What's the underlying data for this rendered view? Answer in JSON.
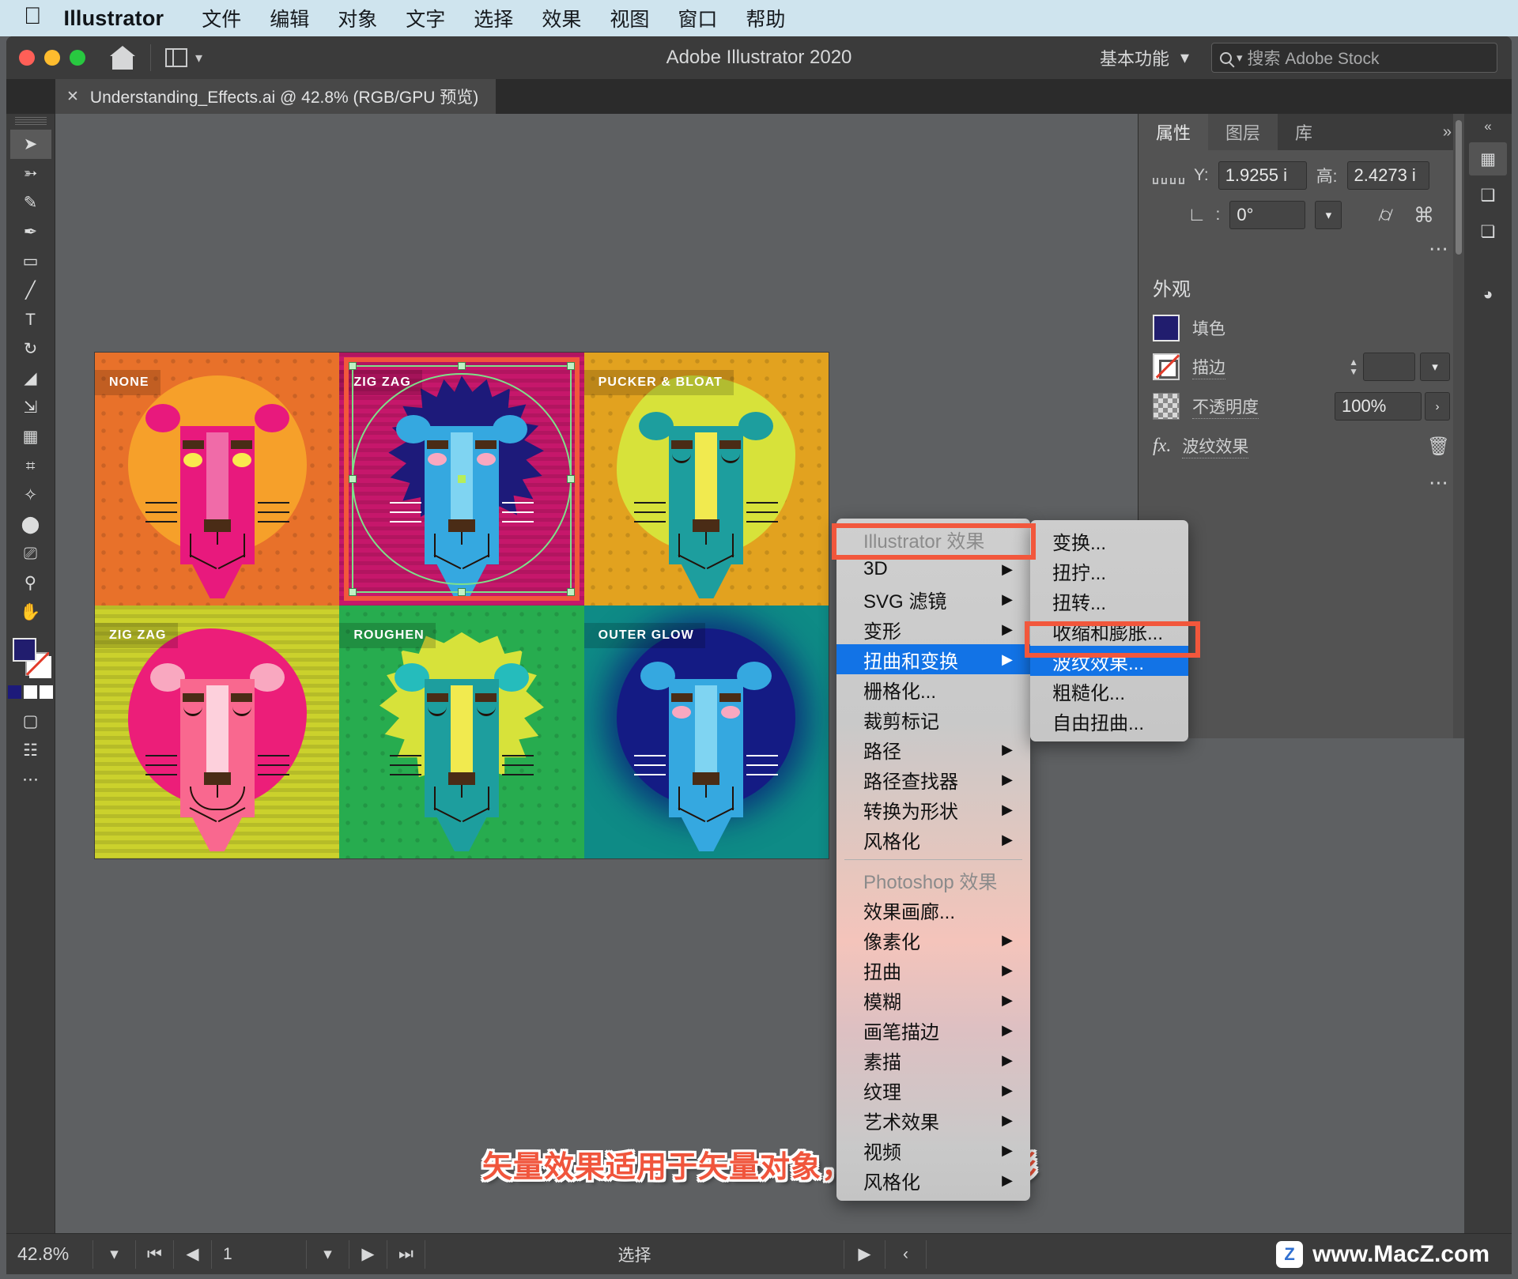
{
  "macmenu": {
    "apple_icon": "apple-icon",
    "app_name": "Illustrator",
    "items": [
      "文件",
      "编辑",
      "对象",
      "文字",
      "选择",
      "效果",
      "视图",
      "窗口",
      "帮助"
    ]
  },
  "titlebar": {
    "title": "Adobe Illustrator 2020",
    "home_icon": "home-icon",
    "arrange_icon": "arrange-documents-icon",
    "workspace_label": "基本功能",
    "workspace_caret": "chevron-down-icon",
    "search_icon": "search-icon",
    "search_caret": "chevron-down-icon",
    "search_placeholder": "搜索 Adobe Stock"
  },
  "tab": {
    "close_icon": "close-icon",
    "title": "Understanding_Effects.ai @ 42.8% (RGB/GPU 预览)"
  },
  "toolbar": {
    "tools": [
      {
        "name": "selection-tool",
        "glyph": "➤"
      },
      {
        "name": "direct-selection-tool",
        "glyph": "➣"
      },
      {
        "name": "pen-tool",
        "glyph": "✒"
      },
      {
        "name": "curvature-tool",
        "glyph": "✎"
      },
      {
        "name": "rectangle-tool",
        "glyph": "▭"
      },
      {
        "name": "paintbrush-tool",
        "glyph": "🖌"
      },
      {
        "name": "type-tool",
        "glyph": "T"
      },
      {
        "name": "rotate-tool",
        "glyph": "↻"
      },
      {
        "name": "eraser-tool",
        "glyph": "◣"
      },
      {
        "name": "scale-tool",
        "glyph": "⇲"
      },
      {
        "name": "gradient-tool",
        "glyph": "▤"
      },
      {
        "name": "eyedropper-tool",
        "glyph": "⌖"
      },
      {
        "name": "blend-tool",
        "glyph": "✧"
      },
      {
        "name": "shape-builder-tool",
        "glyph": "⬤"
      },
      {
        "name": "artboard-tool",
        "glyph": "⛶"
      },
      {
        "name": "zoom-tool",
        "glyph": "🔍"
      },
      {
        "name": "hand-tool",
        "glyph": "✋"
      },
      {
        "name": "more-tools",
        "glyph": "•••"
      }
    ],
    "fill_color": "#211d6e",
    "stroke_color": "none"
  },
  "rightdock": {
    "expand_icon": "chevrons-left-icon",
    "buttons": [
      {
        "name": "properties-dock-icon",
        "glyph": "▦"
      },
      {
        "name": "layers-dock-icon",
        "glyph": "❑"
      },
      {
        "name": "libraries-dock-icon",
        "glyph": "❏"
      },
      {
        "name": "color-guide-dock-icon",
        "glyph": "◕"
      }
    ]
  },
  "properties": {
    "tabs": [
      {
        "label": "属性",
        "active": true
      },
      {
        "label": "图层",
        "active": false
      },
      {
        "label": "库",
        "active": false
      }
    ],
    "more_icon": "chevrons-right-icon",
    "transform": {
      "y_label": "Y:",
      "y_value": "1.9255 i",
      "h_label": "高:",
      "h_value": "2.4273 i",
      "angle_label": "角度",
      "angle_value": "0°",
      "flip_h_icon": "flip-horizontal-icon",
      "flip_v_icon": "flip-vertical-icon",
      "more_icon": "more-options-icon"
    },
    "appearance": {
      "section_title": "外观",
      "fill_label": "填色",
      "fill_color": "#211d6e",
      "stroke_label": "描边",
      "stroke_value": "",
      "opacity_label": "不透明度",
      "opacity_value": "100%",
      "opacity_caret": "chevron-right-icon",
      "effect_label": "波纹效果",
      "effect_fx_icon": "fx-icon",
      "delete_icon": "trash-icon",
      "more_icon": "more-options-icon"
    }
  },
  "effects_menu": {
    "header_illustrator": "Illustrator 效果",
    "items_illustrator": [
      {
        "label": "3D",
        "submenu": true
      },
      {
        "label": "SVG 滤镜",
        "submenu": true
      },
      {
        "label": "变形",
        "submenu": true
      },
      {
        "label": "扭曲和变换",
        "submenu": true,
        "selected": true,
        "highlight": true
      },
      {
        "label": "栅格化...",
        "submenu": false
      },
      {
        "label": "裁剪标记",
        "submenu": false
      },
      {
        "label": "路径",
        "submenu": true
      },
      {
        "label": "路径查找器",
        "submenu": true
      },
      {
        "label": "转换为形状",
        "submenu": true
      },
      {
        "label": "风格化",
        "submenu": true
      }
    ],
    "header_photoshop": "Photoshop 效果",
    "items_photoshop": [
      {
        "label": "效果画廊...",
        "submenu": false
      },
      {
        "label": "像素化",
        "submenu": true
      },
      {
        "label": "扭曲",
        "submenu": true
      },
      {
        "label": "模糊",
        "submenu": true
      },
      {
        "label": "画笔描边",
        "submenu": true
      },
      {
        "label": "素描",
        "submenu": true
      },
      {
        "label": "纹理",
        "submenu": true
      },
      {
        "label": "艺术效果",
        "submenu": true
      },
      {
        "label": "视频",
        "submenu": true
      },
      {
        "label": "风格化",
        "submenu": true
      }
    ]
  },
  "distort_submenu": {
    "items": [
      {
        "label": "变换...",
        "selected": false
      },
      {
        "label": "扭拧...",
        "selected": false
      },
      {
        "label": "扭转...",
        "selected": false
      },
      {
        "label": "收缩和膨胀...",
        "selected": false
      },
      {
        "label": "波纹效果...",
        "selected": true,
        "highlight": true
      },
      {
        "label": "粗糙化...",
        "selected": false
      },
      {
        "label": "自由扭曲...",
        "selected": false
      }
    ]
  },
  "artboard": {
    "cells": [
      {
        "label": "NONE",
        "bg": "#e8712a",
        "pattern": "dots",
        "mane": "#f6a02a",
        "mane_shape": "circle",
        "face": "#e8197d",
        "ear": "#e8197d",
        "snout": "#f06ba8",
        "body": "#e8197d"
      },
      {
        "label": "ZIG ZAG",
        "bg": "#c6176b",
        "pattern": "stripes",
        "mane": "#1d1a7a",
        "mane_shape": "spike",
        "face": "#35a8e0",
        "ear": "#35a8e0",
        "snout": "#7fd4f2",
        "body": "#35a8e0",
        "selected": true
      },
      {
        "label": "PUCKER & BLOAT",
        "bg": "#e2a21f",
        "pattern": "dots",
        "mane": "#d7e23a",
        "mane_shape": "bloat",
        "face": "#1d9e9e",
        "ear": "#1d9e9e",
        "snout": "#f1ea4f",
        "body": "#1d9e9e"
      },
      {
        "label": "ZIG ZAG",
        "bg": "#cbd12c",
        "pattern": "stripes",
        "mane": "#ec1e79",
        "mane_shape": "zigzag",
        "face": "#f9688f",
        "ear": "#f9a8c0",
        "snout": "#fdd0dc",
        "body": "#ec1e79"
      },
      {
        "label": "ROUGHEN",
        "bg": "#27ac4f",
        "pattern": "dots",
        "mane": "#d7e23a",
        "mane_shape": "rough",
        "face": "#1d9e9e",
        "ear": "#25bcbc",
        "snout": "#f1ea4f",
        "body": "#1d9e9e"
      },
      {
        "label": "OUTER GLOW",
        "bg": "#0e8b86",
        "pattern": "none",
        "mane": "#141b84",
        "mane_shape": "circle",
        "face": "#35a8e0",
        "ear": "#35a8e0",
        "snout": "#7fd4f2",
        "body": "#35a8e0"
      }
    ]
  },
  "caption": {
    "text": "矢量效果适用于矢量对象，例如这个圆形",
    "color": "#f0553c"
  },
  "status": {
    "zoom": "42.8%",
    "zoom_caret": "chevron-down-icon",
    "first_page_icon": "first-page-icon",
    "prev_page_icon": "prev-page-icon",
    "page": "1",
    "page_caret": "chevron-down-icon",
    "next_page_icon": "next-page-icon",
    "last_page_icon": "last-page-icon",
    "tool_status": "选择",
    "status_next_icon": "play-icon",
    "status_prev_icon": "chevron-left-icon"
  },
  "watermark": {
    "badge": "Z",
    "text": "www.MacZ.com"
  }
}
